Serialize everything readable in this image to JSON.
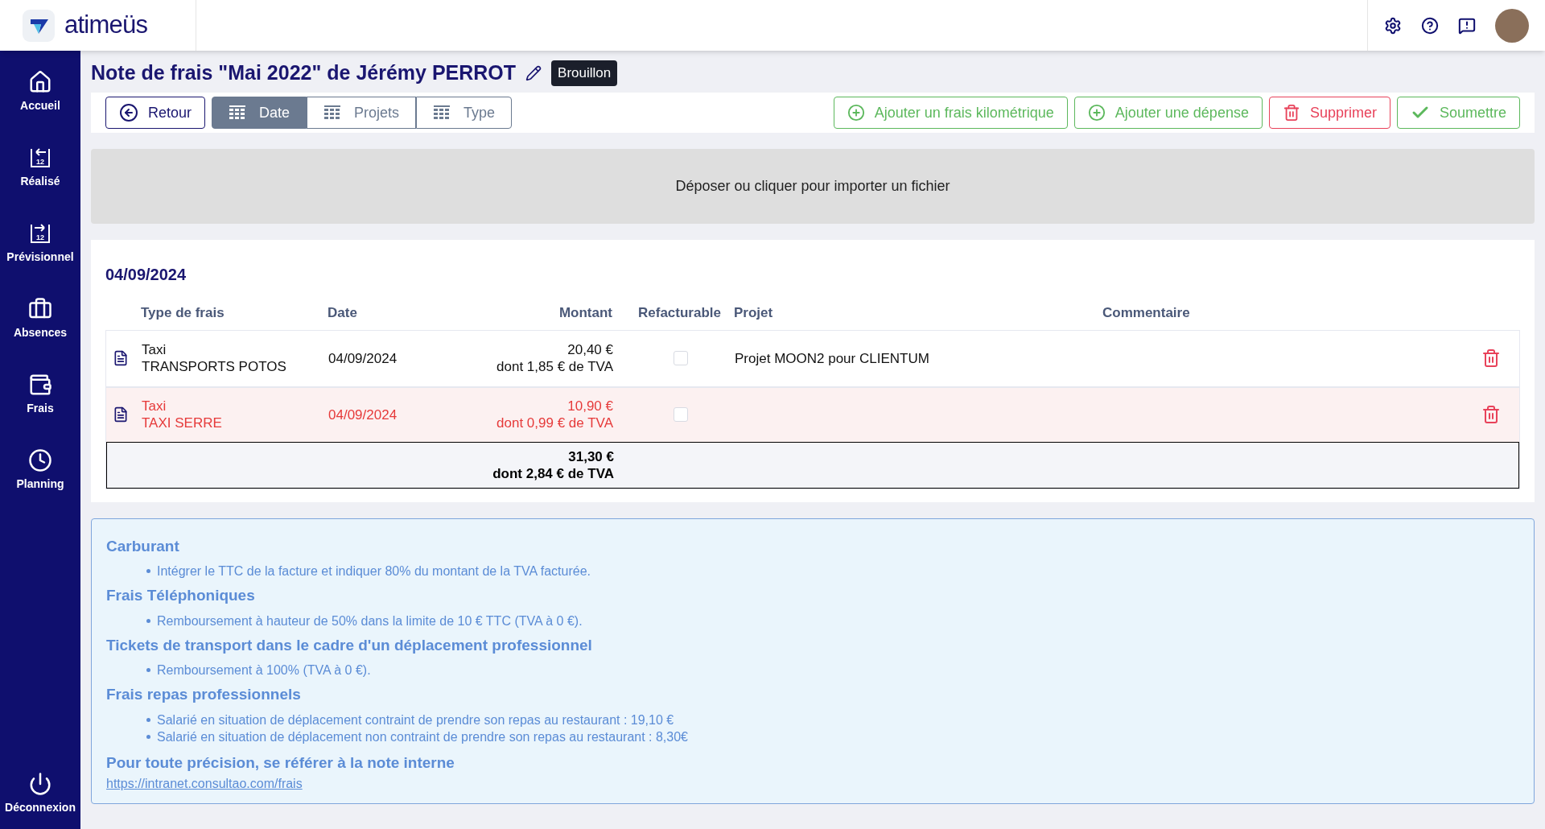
{
  "header": {
    "logo_text": "atimeüs"
  },
  "sidebar": {
    "items": [
      {
        "label": "Accueil",
        "kind": "home"
      },
      {
        "label": "Réalisé",
        "kind": "past",
        "icon_text": "12"
      },
      {
        "label": "Prévisionnel",
        "kind": "future",
        "icon_text": "12"
      },
      {
        "label": "Absences",
        "kind": "bag"
      },
      {
        "label": "Frais",
        "kind": "wallet"
      },
      {
        "label": "Planning",
        "kind": "clock"
      }
    ],
    "logout": "Déconnexion"
  },
  "page": {
    "title": "Note de frais \"Mai 2022\" de Jérémy PERROT",
    "status": "Brouillon"
  },
  "toolbar": {
    "back": "Retour",
    "group_tabs": [
      {
        "label": "Date",
        "selected": true
      },
      {
        "label": "Projets",
        "selected": false
      },
      {
        "label": "Type",
        "selected": false
      }
    ],
    "actions": [
      {
        "label": "Ajouter un frais kilométrique",
        "kind": "add"
      },
      {
        "label": "Ajouter une dépense",
        "kind": "add"
      },
      {
        "label": "Supprimer",
        "kind": "delete"
      },
      {
        "label": "Soumettre",
        "kind": "submit"
      }
    ]
  },
  "dropzone": {
    "text": "Déposer ou cliquer pour importer un fichier"
  },
  "table": {
    "group_title": "04/09/2024",
    "columns": [
      "Type de frais",
      "Date",
      "Montant",
      "Refacturable",
      "Projet",
      "Commentaire"
    ],
    "rows": [
      {
        "type": "Taxi",
        "supplier": "TRANSPORTS POTOS",
        "date": "04/09/2024",
        "amount": "20,40 €",
        "vat": "dont 1,85 € de TVA",
        "rebillable": false,
        "project": "Projet MOON2 pour CLIENTUM",
        "flagged": false
      },
      {
        "type": "Taxi",
        "supplier": "TAXI SERRE",
        "date": "04/09/2024",
        "amount": "10,90 €",
        "vat": "dont 0,99 € de TVA",
        "rebillable": false,
        "flagged": true
      }
    ],
    "total": {
      "amount": "31,30 €",
      "vat": "dont 2,84 € de TVA"
    }
  },
  "info": {
    "sections": [
      {
        "title": "Carburant",
        "bullets": [
          "Intégrer le TTC de la facture et indiquer 80% du montant de la TVA facturée."
        ]
      },
      {
        "title": "Frais Téléphoniques",
        "bullets": [
          "Remboursement à hauteur de 50% dans la limite de 10 € TTC (TVA à 0 €)."
        ]
      },
      {
        "title": "Tickets de transport dans le cadre d'un déplacement professionnel",
        "bullets": [
          "Remboursement à 100% (TVA à 0 €)."
        ]
      },
      {
        "title": "Frais repas professionnels",
        "bullets": [
          "Salarié en situation de déplacement contraint de prendre son repas au restaurant : 19,10 €",
          "Salarié en situation de déplacement non contraint de prendre son repas au restaurant : 8,30€"
        ]
      }
    ],
    "footer_title": "Pour toute précision, se référer à la note interne",
    "link": "https://intranet.consultao.com/frais"
  }
}
